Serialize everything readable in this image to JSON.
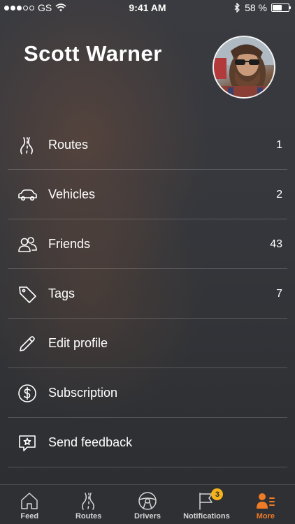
{
  "status_bar": {
    "carrier": "GS",
    "time": "9:41 AM",
    "battery_percent": "58 %",
    "battery_level": 0.58
  },
  "profile": {
    "name": "Scott Warner"
  },
  "menu": [
    {
      "label": "Routes",
      "count": "1",
      "icon": "routes-icon"
    },
    {
      "label": "Vehicles",
      "count": "2",
      "icon": "car-icon"
    },
    {
      "label": "Friends",
      "count": "43",
      "icon": "friends-icon"
    },
    {
      "label": "Tags",
      "count": "7",
      "icon": "tag-icon"
    },
    {
      "label": "Edit profile",
      "count": "",
      "icon": "pencil-icon"
    },
    {
      "label": "Subscription",
      "count": "",
      "icon": "dollar-icon"
    },
    {
      "label": "Send feedback",
      "count": "",
      "icon": "feedback-icon"
    }
  ],
  "tabs": [
    {
      "label": "Feed",
      "icon": "home-icon"
    },
    {
      "label": "Routes",
      "icon": "routes-icon"
    },
    {
      "label": "Drivers",
      "icon": "steering-wheel-icon"
    },
    {
      "label": "Notifications",
      "icon": "flag-icon",
      "badge": "3"
    },
    {
      "label": "More",
      "icon": "person-list-icon",
      "active": true
    }
  ],
  "colors": {
    "accent": "#f07b26",
    "badge": "#f5b21a"
  }
}
